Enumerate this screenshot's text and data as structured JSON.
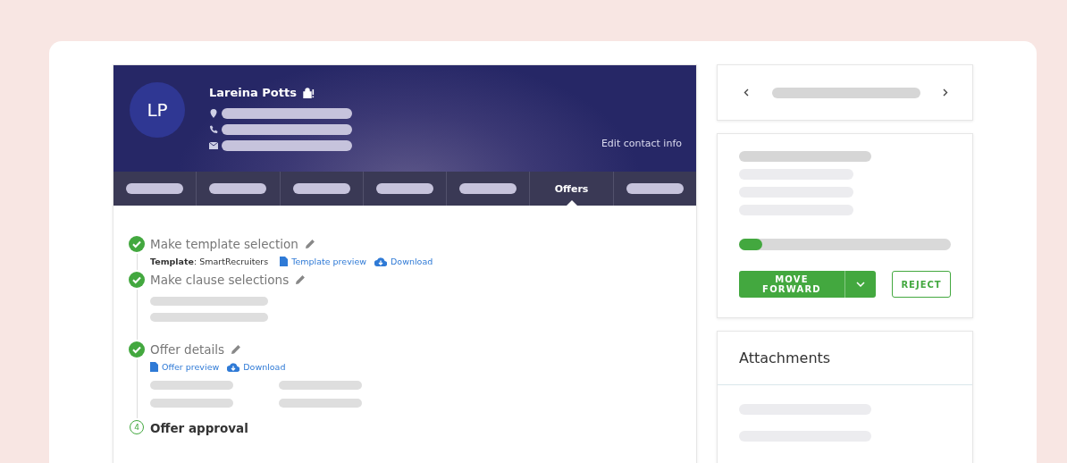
{
  "profile": {
    "initials": "LP",
    "name": "Lareina Potts",
    "edit_link": "Edit contact info"
  },
  "tabs": [
    {
      "kind": "placeholder",
      "selected": false
    },
    {
      "kind": "placeholder",
      "selected": false
    },
    {
      "kind": "placeholder",
      "selected": false
    },
    {
      "kind": "placeholder",
      "selected": false
    },
    {
      "kind": "placeholder",
      "selected": false
    },
    {
      "kind": "text",
      "label": "Offers",
      "selected": true
    },
    {
      "kind": "placeholder",
      "selected": false
    }
  ],
  "steps": [
    {
      "title": "Make template selection",
      "done": true,
      "kind": "template",
      "note": "**Template**: SmartRecruiters",
      "links": [
        {
          "kind": "document",
          "label": "Template preview"
        },
        {
          "kind": "cloud",
          "label": "Download"
        }
      ]
    },
    {
      "title": "Make clause selections",
      "done": true,
      "kind": "clauses"
    },
    {
      "title": "Offer details",
      "done": true,
      "kind": "details",
      "links": [
        {
          "kind": "document",
          "label": "Offer preview"
        },
        {
          "kind": "cloud",
          "label": "Download"
        }
      ]
    },
    {
      "title": "Offer approval",
      "done": false,
      "number": "4",
      "kind": "pending"
    }
  ],
  "progress": {
    "level": 0.11
  },
  "buttons": {
    "primary": "MOVE FORWARD",
    "secondary": "REJECT"
  },
  "attachments": {
    "title": "Attachments"
  }
}
